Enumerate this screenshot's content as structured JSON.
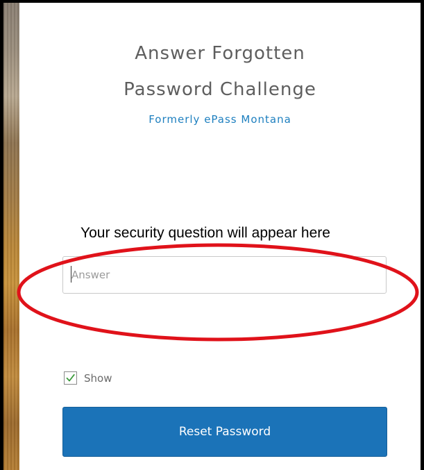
{
  "header": {
    "title_line1": "Answer Forgotten",
    "title_line2": "Password Challenge",
    "subtitle": "Formerly ePass Montana"
  },
  "form": {
    "question_text": "Your security question will appear here",
    "answer_placeholder": "Answer",
    "answer_value": "",
    "show_label": "Show",
    "show_checked": true,
    "submit_label": "Reset Password"
  },
  "colors": {
    "title": "#5e5e5e",
    "subtitle": "#1d7fbf",
    "button": "#1b73b8",
    "highlight": "#e0121a"
  },
  "icons": {
    "checkbox_mark": "check-icon"
  }
}
